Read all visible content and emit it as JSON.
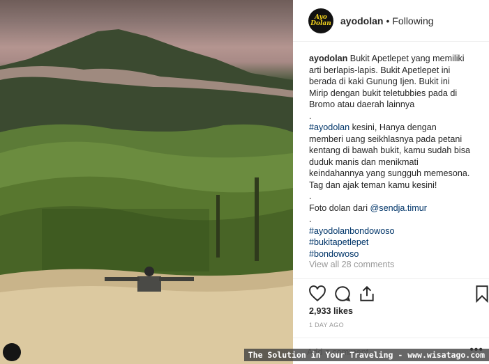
{
  "post": {
    "username": "ayodolan",
    "separator": "•",
    "follow_status": "Following",
    "avatar_text_1": "Ayo",
    "avatar_text_2": "Dolan",
    "caption_user": "ayodolan",
    "caption_lines": [
      "Bukit Apetlepet yang memiliki",
      "arti berlapis-lapis. Bukit Apetlepet ini",
      "berada di kaki Gunung Ijen. Bukit ini",
      "Mirip dengan bukit teletubbies pada di",
      "Bromo atau daerah lainnya",
      "."
    ],
    "hashtag_intro": "#ayodolan",
    "intro_lines": [
      "kesini, Hanya dengan",
      "memberi uang seikhlasnya pada petani",
      "kentang di bawah bukit, kamu sudah bisa",
      "duduk manis dan menikmati",
      "keindahannya yang sungguh memesona.",
      "Tag dan ajak teman kamu kesini!",
      "."
    ],
    "credit_text": "Foto dolan dari",
    "credit_user": "@sendja.timur",
    "credit_dot": ".",
    "hashtags": [
      "#ayodolanbondowoso",
      "#bukitapetlepet",
      "#bondowoso"
    ],
    "view_comments": "View all 28 comments",
    "likes": "2,933 likes",
    "time": "1 DAY AGO",
    "comment_placeholder": "Add a comment...",
    "more": "•••"
  },
  "icons": [
    "heart-icon",
    "comment-icon",
    "share-icon",
    "bookmark-icon",
    "more-icon"
  ],
  "colors": {
    "link": "#003569",
    "muted": "#999999",
    "text": "#262626",
    "avatar_bg": "#111111",
    "avatar_fg": "#f1d21d"
  },
  "watermark": "The Solution in Your Traveling - www.wisatago.com"
}
